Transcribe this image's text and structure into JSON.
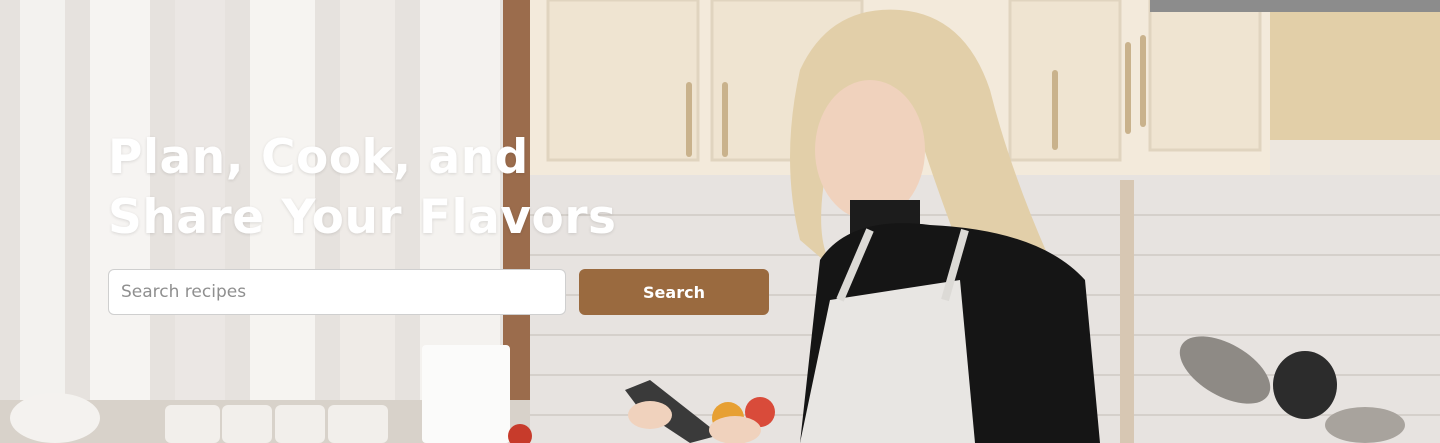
{
  "hero": {
    "title_line1": "Plan, Cook, and",
    "title_line2": "Share Your Flavors",
    "image_alt": "woman-using-tablet-in-kitchen"
  },
  "search": {
    "placeholder": "Search recipes",
    "value": "",
    "button_label": "Search"
  },
  "colors": {
    "button": "#9a6a3f",
    "title": "#ffffff",
    "input_background": "#ffffff"
  }
}
